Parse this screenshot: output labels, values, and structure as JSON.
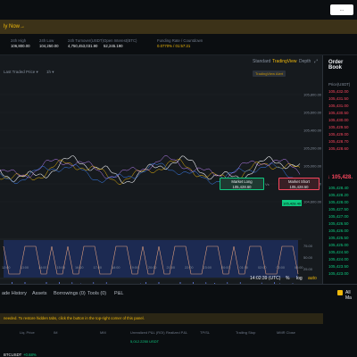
{
  "banner": {
    "text": "ly Now→"
  },
  "topbar": {
    "signin_label": "..."
  },
  "stats": [
    {
      "label": "24h High",
      "value": "106,800.00",
      "cls": "v"
    },
    {
      "label": "24h Low",
      "value": "104,250.00",
      "cls": "v"
    },
    {
      "label": "24h Turnover(USDT)",
      "value": "4,750,453,031.90",
      "cls": "v"
    },
    {
      "label": "Open Interest(BTC)",
      "value": "52,245.190",
      "cls": "v"
    },
    {
      "label": "Funding Rate / Countdown",
      "value": "0.0770% / 01:57:21",
      "cls": "y"
    }
  ],
  "chart": {
    "views": {
      "standard": "Standard",
      "tradingview": "TradingView",
      "depth": "Depth"
    },
    "last_traded": "Last Traded Price",
    "interval": "1h",
    "ohlc": "105,428.40 (0.00%)",
    "tv_alert": "TradingView Alert",
    "price_ticks": [
      "105,800.00",
      "105,600.00",
      "105,400.00",
      "105,200.00",
      "105,000.00",
      "104,800.00",
      "104,600.00"
    ],
    "current_price_tag": "105,428.40",
    "market_long": {
      "label": "Market Long",
      "value": "105,428.60"
    },
    "market_short": {
      "label": "Market Short",
      "value": "105,428.50"
    },
    "vs_label": "Vs",
    "osc_ticks": [
      "75.00",
      "50.00",
      "25.00"
    ],
    "time_ticks": [
      "12:00",
      "13:00",
      "14:00",
      "15:00",
      "16:00",
      "17:00",
      "18:00",
      "19:00",
      "20:00",
      "21:00",
      "22:00",
      "23:00",
      "00:00",
      "01:00",
      "02:00",
      "03:00",
      "04:00"
    ],
    "clock": "14:02:39 (UTC)",
    "pct": "%",
    "log": "log",
    "auto": "auto"
  },
  "orderbook": {
    "title": "Order Book",
    "price_header": "Price(USDT)",
    "asks": [
      "105,432.00",
      "105,431.50",
      "105,431.00",
      "105,430.50",
      "105,430.00",
      "105,429.50",
      "105,429.00",
      "105,428.70",
      "105,428.60"
    ],
    "mid": "↓ 105,428.",
    "bids": [
      "105,428.40",
      "105,428.20",
      "105,428.00",
      "105,427.50",
      "105,427.00",
      "105,426.50",
      "105,426.00",
      "105,425.50",
      "105,425.00",
      "105,424.50",
      "105,424.00",
      "105,423.50",
      "105,423.00"
    ]
  },
  "bottom": {
    "tabs": [
      "ade History",
      "Assets",
      "Borrowings (0)",
      "Tools (0)",
      "P&L"
    ],
    "all_markets": "All Ma",
    "warning": "needed. To restore hidden tabs, click the  button in the top-right corner of this panel.",
    "columns": [
      "Liq. Price",
      "IM",
      "MM",
      "Unrealized P&L (ROI)",
      "Realized P&L",
      "TP/SL",
      "Trailing Stop",
      "MMR Close"
    ],
    "row": [
      "",
      "",
      "",
      "5,012.2250 USDT",
      "",
      "",
      "",
      ""
    ],
    "pair": "BTCUSDT",
    "pair_change": "+0.68%"
  }
}
